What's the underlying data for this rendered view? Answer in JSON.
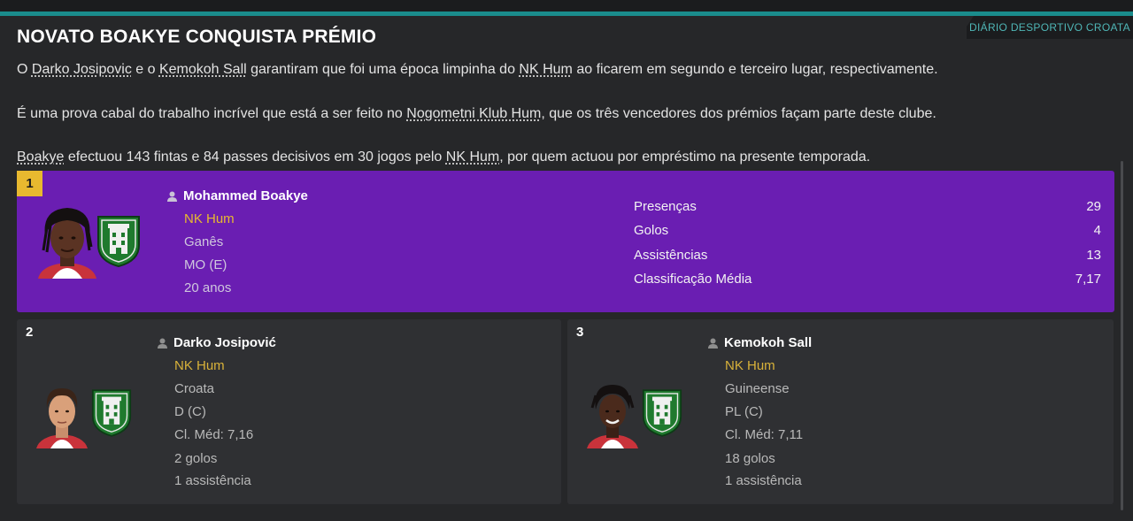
{
  "article": {
    "source": "DIÁRIO DESPORTIVO CROATA",
    "title": "NOVATO BOAKYE CONQUISTA PRÉMIO",
    "para1": {
      "p1": "O ",
      "l1": "Darko Josipovic",
      "p2": " e o ",
      "l2": "Kemokoh Sall",
      "p3": " garantiram que foi uma época limpinha do ",
      "l3": "NK Hum",
      "p4": " ao ficarem em segundo e terceiro lugar, respectivamente."
    },
    "para2": {
      "p1": "É uma prova cabal do trabalho incrível que está a ser feito no ",
      "l1": "Nogometni Klub Hum",
      "p2": ", que os três vencedores dos prémios façam parte deste clube."
    },
    "para3": {
      "l1": "Boakye",
      "p1": " efectuou 143 fintas e 84 passes decisivos em 30 jogos pelo ",
      "l2": "NK Hum",
      "p2": ", por quem actuou por empréstimo na presente temporada."
    }
  },
  "winner": {
    "rank": "1",
    "name": "Mohammed Boakye",
    "club": "NK Hum",
    "nationality": "Ganês",
    "position": "MO (E)",
    "age": "20 anos",
    "stats": [
      {
        "label": "Presenças",
        "value": "29"
      },
      {
        "label": "Golos",
        "value": "4"
      },
      {
        "label": "Assistências",
        "value": "13"
      },
      {
        "label": "Classificação Média",
        "value": "7,17"
      }
    ]
  },
  "runners": [
    {
      "rank": "2",
      "name": "Darko Josipović",
      "club": "NK Hum",
      "nationality": "Croata",
      "position": "D (C)",
      "rating": "Cl. Méd: 7,16",
      "goals": "2 golos",
      "assists": "1 assistência"
    },
    {
      "rank": "3",
      "name": "Kemokoh Sall",
      "club": "NK Hum",
      "nationality": "Guineense",
      "position": "PL (C)",
      "rating": "Cl. Méd: 7,11",
      "goals": "18 golos",
      "assists": "1 assistência"
    }
  ],
  "colors": {
    "accent": "#1a8c8c",
    "winner_bg": "#6a1eb2",
    "gold": "#e8b92f",
    "crest_green": "#1f7a2e"
  },
  "icons": [
    "person-icon",
    "club-crest-icon",
    "player-face"
  ]
}
